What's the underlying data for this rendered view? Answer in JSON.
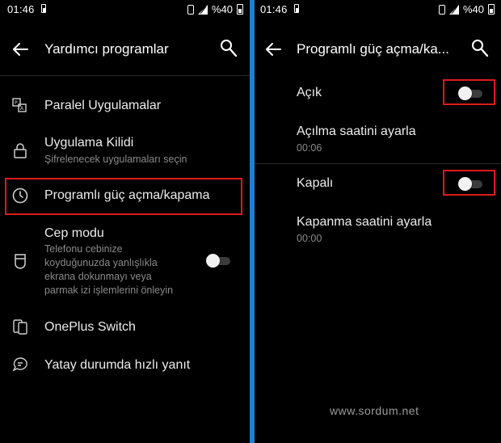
{
  "status_bar": {
    "time": "01:46",
    "battery_percent": "%40"
  },
  "left": {
    "title": "Yardımcı programlar",
    "items": [
      {
        "label": "Paralel Uygulamalar",
        "icon": "parallel-apps-icon"
      },
      {
        "label": "Uygulama Kilidi",
        "sub": "Şifrelenecek uygulamaları seçin",
        "icon": "lock-icon"
      },
      {
        "label": "Programlı güç açma/kapama",
        "icon": "clock-icon",
        "highlighted": true
      },
      {
        "label": "Cep modu",
        "sub": [
          "Telefonu cebinize",
          "koyduğunuzda yanlışlıkla",
          "ekrana dokunmayı veya",
          "parmak izi işlemlerini önleyin"
        ],
        "icon": "pocket-icon",
        "toggle": false
      },
      {
        "label": "OnePlus Switch",
        "icon": "switch-icon"
      },
      {
        "label": "Yatay durumda hızlı yanıt",
        "icon": "quick-reply-icon"
      }
    ]
  },
  "right": {
    "title": "Programlı güç açma/ka...",
    "on_label": "Açık",
    "on_toggle": false,
    "on_time_label": "Açılma saatini ayarla",
    "on_time_value": "00:06",
    "off_label": "Kapalı",
    "off_toggle": false,
    "off_time_label": "Kapanma saatini ayarla",
    "off_time_value": "00:00"
  },
  "watermark": "www.sordum.net",
  "colors": {
    "accent_divider": "#1e7fd6",
    "highlight_box": "#e0191b",
    "background": "#000000"
  }
}
